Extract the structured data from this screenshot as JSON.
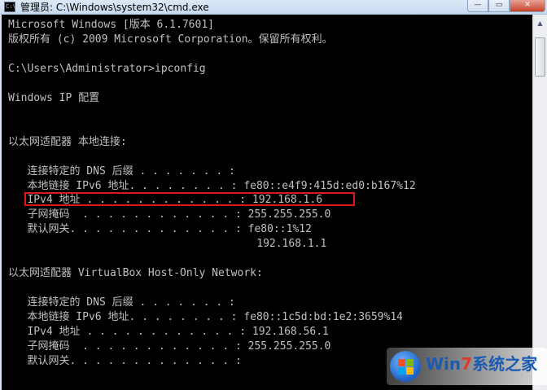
{
  "window": {
    "title": "管理员: C:\\Windows\\system32\\cmd.exe",
    "minimize_glyph": "—",
    "maximize_glyph": "▭",
    "close_glyph": "✕",
    "icon": "cmd-icon",
    "icon_prompt": "C:\\"
  },
  "console": {
    "lines": [
      "Microsoft Windows [版本 6.1.7601]",
      "版权所有 (c) 2009 Microsoft Corporation。保留所有权利。",
      "",
      "C:\\Users\\Administrator>ipconfig",
      "",
      "Windows IP 配置",
      "",
      "",
      "以太网适配器 本地连接:",
      "",
      "   连接特定的 DNS 后缀 . . . . . . . :",
      "   本地链接 IPv6 地址. . . . . . . . : fe80::e4f9:415d:ed0:b167%12",
      "   IPv4 地址 . . . . . . . . . . . . : 192.168.1.6",
      "   子网掩码  . . . . . . . . . . . . : 255.255.255.0",
      "   默认网关. . . . . . . . . . . . . : fe80::1%12",
      "                                       192.168.1.1",
      "",
      "以太网适配器 VirtualBox Host-Only Network:",
      "",
      "   连接特定的 DNS 后缀 . . . . . . . :",
      "   本地链接 IPv6 地址. . . . . . . . : fe80::1c5d:bd:1e2:3659%14",
      "   IPv4 地址 . . . . . . . . . . . . : 192.168.56.1",
      "   子网掩码  . . . . . . . . . . . . : 255.255.255.0",
      "   默认网关. . . . . . . . . . . . . :"
    ],
    "text_color": "#c0c0c0",
    "background": "#000000",
    "highlight_color": "#e0161a"
  },
  "scrollbar": {
    "up_glyph": "▲",
    "down_glyph": "▼"
  },
  "watermark": {
    "brand": "Win",
    "accent": "7",
    "suffix": "系统之家"
  }
}
